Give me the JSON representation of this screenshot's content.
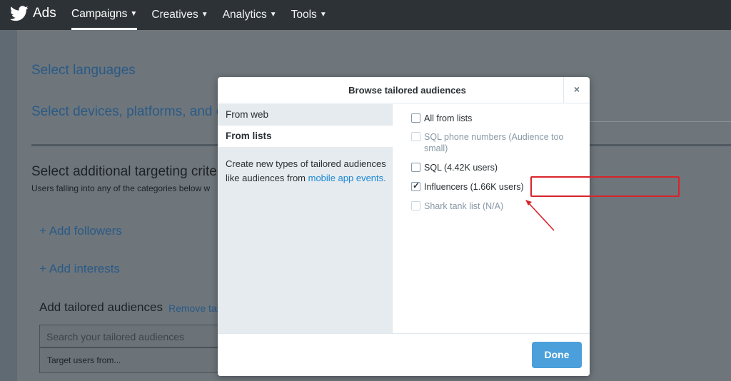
{
  "topbar": {
    "brand": "Ads",
    "nav": [
      {
        "label": "Campaigns",
        "active": true
      },
      {
        "label": "Creatives",
        "active": false
      },
      {
        "label": "Analytics",
        "active": false
      },
      {
        "label": "Tools",
        "active": false
      }
    ]
  },
  "background": {
    "select_languages": "Select languages",
    "select_devices": "Select devices, platforms, and ca",
    "additional_targeting": "Select additional targeting criter",
    "additional_targeting_sub": "Users falling into any of the categories below w",
    "add_followers": "+ Add followers",
    "add_interests": "+ Add interests",
    "add_tailored": "Add tailored audiences",
    "remove_link": "Remove tai",
    "search_placeholder": "Search your tailored audiences",
    "target_users": "Target users from..."
  },
  "modal": {
    "title": "Browse tailored audiences",
    "close_glyph": "×",
    "tabs": [
      {
        "label": "From web",
        "selected": false
      },
      {
        "label": "From lists",
        "selected": true
      }
    ],
    "description": "Create new types of tailored audiences like audiences from ",
    "description_link": "mobile app events.",
    "options": [
      {
        "label": "All from lists",
        "checked": false,
        "disabled": false
      },
      {
        "label": "SQL phone numbers (Audience too small)",
        "checked": false,
        "disabled": true
      },
      {
        "label": "SQL (4.42K users)",
        "checked": false,
        "disabled": false
      },
      {
        "label": "Influencers (1.66K users)",
        "checked": true,
        "disabled": false
      },
      {
        "label": "Shark tank list (N/A)",
        "checked": false,
        "disabled": true
      }
    ],
    "done_label": "Done"
  },
  "colors": {
    "topbar": "#2d3236",
    "primary_button": "#4b9fda",
    "link": "#1b87d6",
    "highlight": "#d9232a"
  }
}
